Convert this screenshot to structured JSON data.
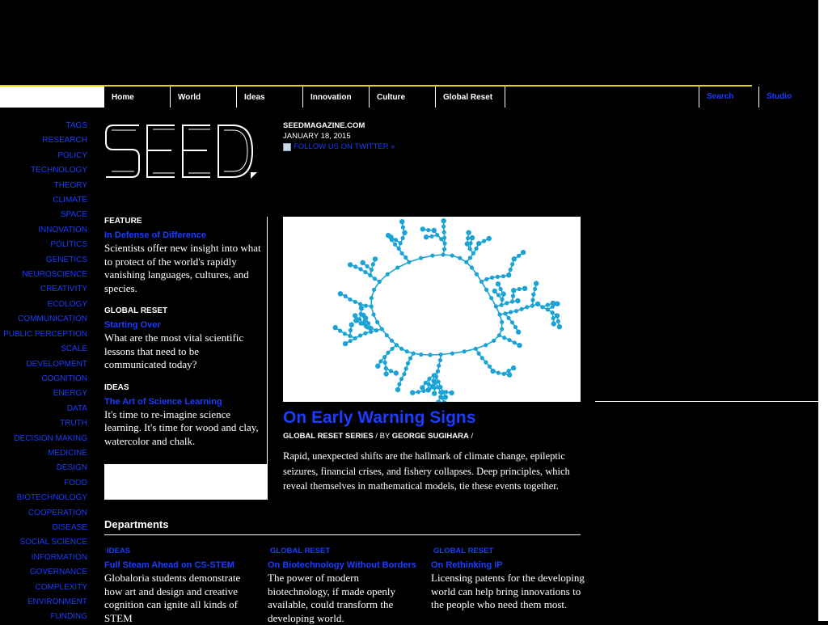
{
  "nav": {
    "items": [
      "Home",
      "World",
      "Ideas",
      "Innovation",
      "Culture",
      "Global Reset"
    ],
    "search": "Search",
    "studio": "Studio"
  },
  "sidebar": {
    "tags": [
      "TAGS",
      "RESEARCH",
      "POLICY",
      "TECHNOLOGY",
      "THEORY",
      "CLIMATE",
      "SPACE",
      "INNOVATION",
      "POLITICS",
      "GENETICS",
      "NEUROSCIENCE",
      "CREATIVITY",
      "ECOLOGY",
      "COMMUNICATION",
      "PUBLIC PERCEPTION",
      "SCALE",
      "DEVELOPMENT",
      "COGNITION",
      "ENERGY",
      "DATA",
      "TRUTH",
      "DECISION MAKING",
      "MEDICINE",
      "DESIGN",
      "FOOD",
      "BIOTECHNOLOGY",
      "COOPERATION",
      "DISEASE",
      "SOCIAL SCIENCE",
      "INFORMATION",
      "GOVERNANCE",
      "COMPLEXITY",
      "ENVIRONMENT",
      "FUNDING"
    ]
  },
  "logo": {
    "text": "SEED"
  },
  "site_info": {
    "site": "SEEDMAGAZINE.COM",
    "date": "JANUARY 18, 2015",
    "twitter": "FOLLOW US ON TWITTER »"
  },
  "features": [
    {
      "kicker": "FEATURE",
      "title": "In Defense of Difference",
      "text": "Scientists offer new insight into what to protect of the world's rapidly vanishing languages, cultures, and species."
    },
    {
      "kicker": "GLOBAL RESET",
      "title": "Starting Over",
      "text": "What are the most vital scientific lessons that need to be communicated today?"
    },
    {
      "kicker": "IDEAS",
      "title": "The Art of Science Learning",
      "text": "It's time to re-imagine science learning. It's time for wood and clay, watercolor and chalk."
    }
  ],
  "main_story": {
    "headline": "On Early Warning Signs",
    "series": "GLOBAL RESET SERIES",
    "by": " / BY ",
    "author": "GEORGE SUGIHARA",
    "trail": " /",
    "summary": "Rapid, unexpected shifts are the hallmark of climate change, epileptic seizures, financial crises, and fishery collapses. Deep principles, which reveal themselves in mathematical models, tie these events together.",
    "image_color": "#1ba3d6"
  },
  "departments": {
    "title": "Departments",
    "items": [
      {
        "kicker": "IDEAS",
        "title": "Full Steam Ahead on CS-STEM",
        "text": "Globaloria students demonstrate how art and design and creative cognition can ignite all kinds of STEM"
      },
      {
        "kicker": "GLOBAL RESET",
        "title": "On Biotechnology Without Borders",
        "text": "The power of modern biotechnology, if made openly available, could transform the developing world."
      },
      {
        "kicker": "GLOBAL RESET",
        "title": "On Rethinking IP",
        "text": "Licensing patents for the developing world can help bring innovations to the people who need them most."
      }
    ]
  },
  "colors": {
    "link": "#1a3dff",
    "accent_line": "#e8d20c",
    "background": "#000000"
  }
}
